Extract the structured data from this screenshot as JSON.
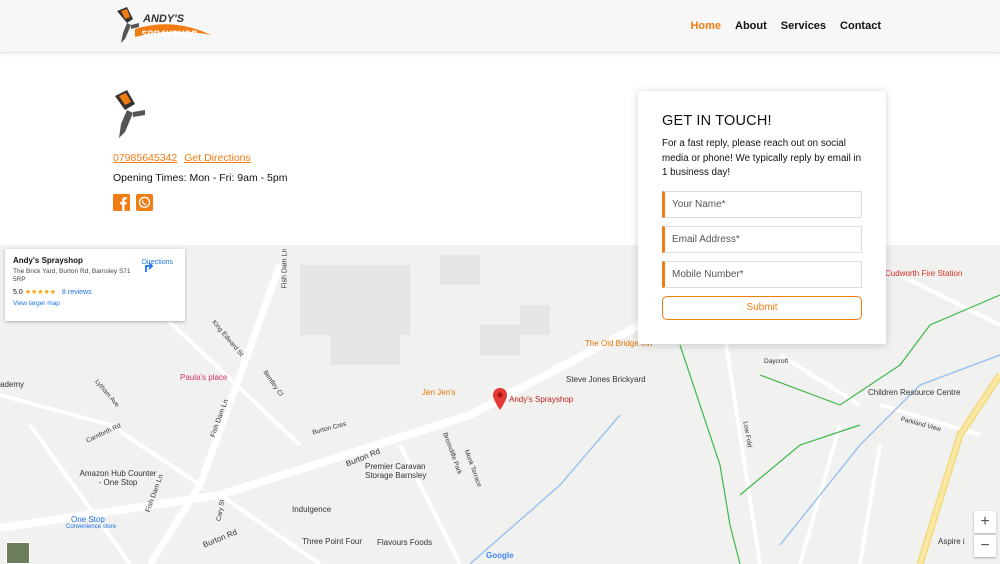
{
  "header": {
    "logo_text": "ANDY'S SPRAYSHOP",
    "nav": [
      {
        "label": "Home",
        "active": true
      },
      {
        "label": "About"
      },
      {
        "label": "Services"
      },
      {
        "label": "Contact"
      }
    ]
  },
  "info": {
    "phone": "07985645342",
    "directions_link": "Get Directions",
    "opening_times": "Opening Times: Mon - Fri: 9am - 5pm",
    "social": [
      "facebook",
      "whatsapp"
    ]
  },
  "contact_card": {
    "title": "GET IN TOUCH!",
    "description": "For a fast reply, please reach out on social media or phone! We typically reply by email in 1 business day!",
    "name_placeholder": "Your Name*",
    "email_placeholder": "Email Address*",
    "mobile_placeholder": "Mobile Number*",
    "submit_label": "Submit"
  },
  "map": {
    "card": {
      "title": "Andy's Sprayshop",
      "address": "The Brick Yard, Burton Rd, Barnsley S71 5RP",
      "rating": "5.0",
      "stars": "★★★★★",
      "reviews": "8 reviews",
      "view_larger": "View larger map",
      "directions": "Directions"
    },
    "labels": {
      "cudworth": "Cudworth Fire Station",
      "old_bridge": "The Old Bridge Inn",
      "steve_jones": "Steve Jones Brickyard",
      "andys": "Andy's Sprayshop",
      "jen_jens": "Jen Jen's",
      "paulas": "Paula's place",
      "children": "Children Resource Centre",
      "premier": "Premier Caravan Storage Barnsley",
      "amazon": "Amazon Hub Counter - One Stop",
      "one_stop": "One Stop",
      "convenience": "Convenience store",
      "indulgence": "Indulgence",
      "three_point": "Three Point Four",
      "flavours": "Flavours Foods",
      "aspire": "Aspire i",
      "academy": "ademy",
      "daycroft": "Daycroft",
      "parkland_view": "Parkland View",
      "burton_rd": "Burton Rd",
      "burton_rd2": "Burton Rd",
      "fish_dam": "Fish Dam Ln",
      "fish_dam2": "Fish Dam Ln",
      "fish_dam3": "Fish Dam Ln",
      "king_edward": "King Edward St",
      "lytham": "Lytham Ave",
      "carnforth": "Carnforth Rd",
      "bentley": "Bentley Cl",
      "burton_cres": "Burton Cres",
      "cary": "Cary St",
      "low_fold": "Low Fold",
      "brommcliffe": "Bromcliffe Park",
      "monk": "Monk Terrace",
      "google": "Google",
      "zoom_in": "+",
      "zoom_out": "−"
    }
  },
  "colors": {
    "accent": "#f07c12",
    "link_blue": "#1a73e8"
  }
}
